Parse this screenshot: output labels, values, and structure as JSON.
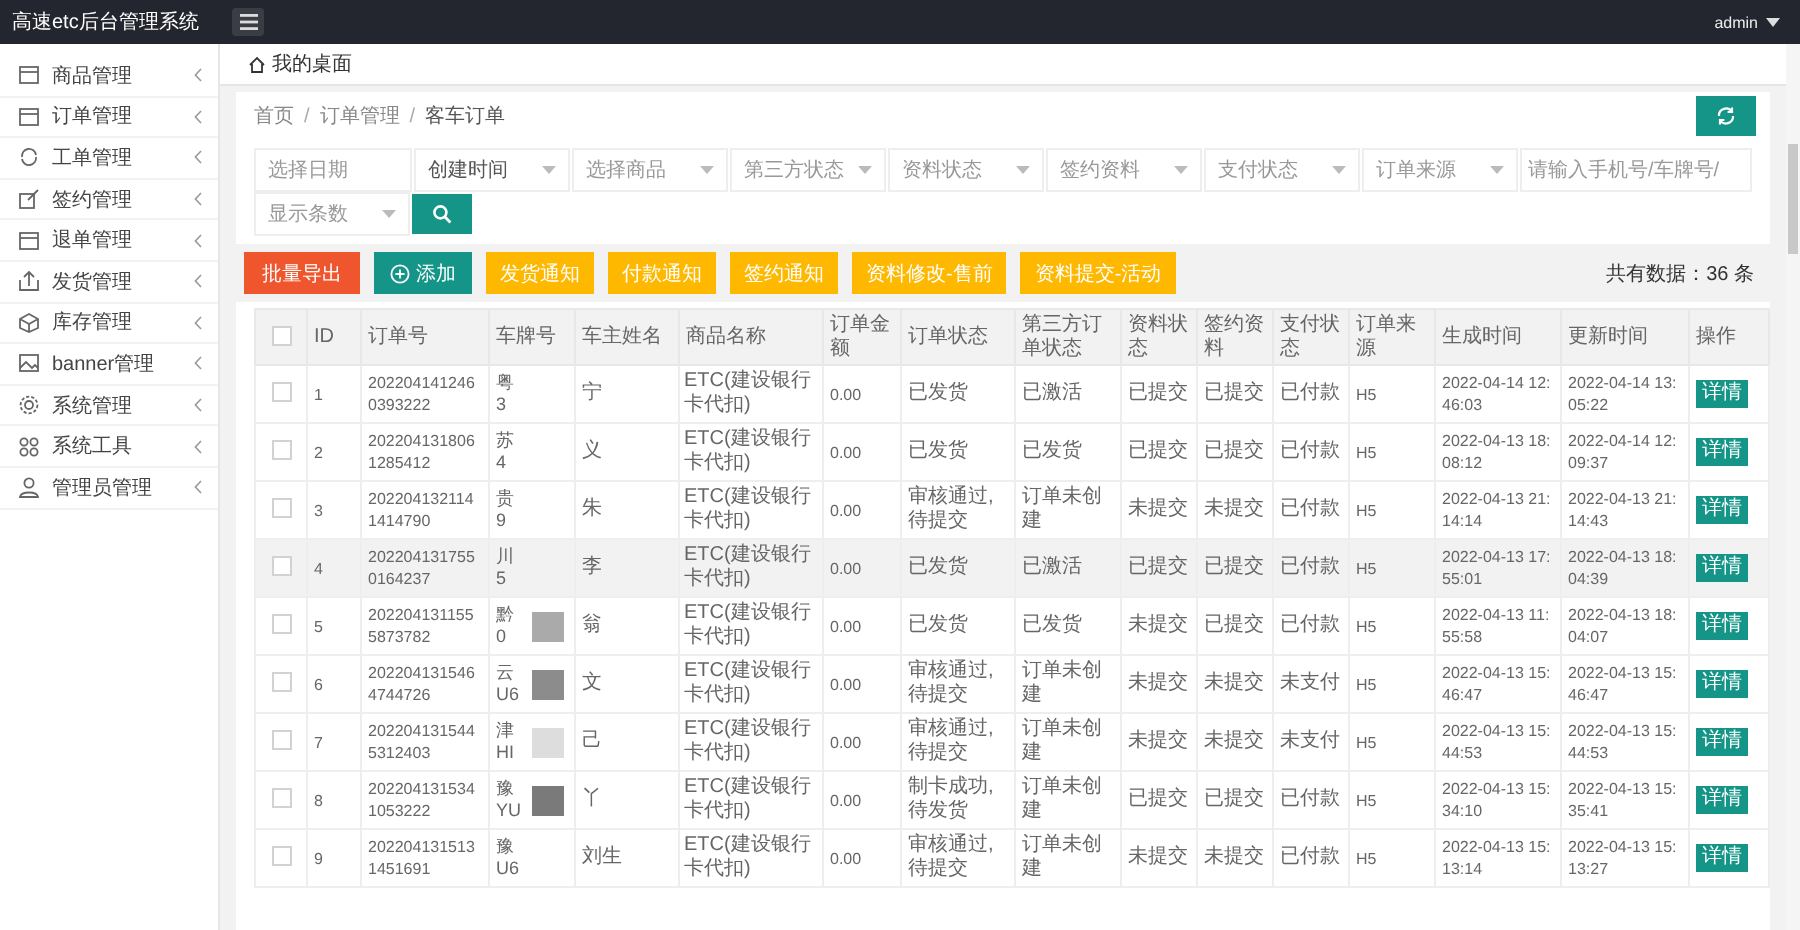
{
  "app_title": "高速etc后台管理系统",
  "user": "admin",
  "sidebar": {
    "items": [
      {
        "label": "商品管理"
      },
      {
        "label": "订单管理"
      },
      {
        "label": "工单管理"
      },
      {
        "label": "签约管理"
      },
      {
        "label": "退单管理"
      },
      {
        "label": "发货管理"
      },
      {
        "label": "库存管理"
      },
      {
        "label": "banner管理"
      },
      {
        "label": "系统管理"
      },
      {
        "label": "系统工具"
      },
      {
        "label": "管理员管理"
      }
    ]
  },
  "tab": {
    "label": "我的桌面"
  },
  "breadcrumb": {
    "separator": "/",
    "items": [
      "首页",
      "订单管理",
      "客车订单"
    ]
  },
  "filters": [
    {
      "kind": "input",
      "placeholder": "选择日期"
    },
    {
      "kind": "select",
      "value": "创建时间"
    },
    {
      "kind": "select",
      "placeholder": "选择商品"
    },
    {
      "kind": "select",
      "placeholder": "第三方状态"
    },
    {
      "kind": "select",
      "placeholder": "资料状态"
    },
    {
      "kind": "select",
      "placeholder": "签约资料"
    },
    {
      "kind": "select",
      "placeholder": "支付状态"
    },
    {
      "kind": "select",
      "placeholder": "订单来源"
    },
    {
      "kind": "input",
      "placeholder": "请输入手机号/车牌号/"
    },
    {
      "kind": "select",
      "placeholder": "显示条数"
    }
  ],
  "actions": [
    {
      "label": "批量导出",
      "kind": "danger"
    },
    {
      "label": "添加",
      "kind": "primary"
    },
    {
      "label": "发货通知",
      "kind": "warning"
    },
    {
      "label": "付款通知",
      "kind": "warning"
    },
    {
      "label": "签约通知",
      "kind": "warning"
    },
    {
      "label": "资料修改-售前",
      "kind": "warning"
    },
    {
      "label": "资料提交-活动",
      "kind": "warning"
    }
  ],
  "total": "共有数据：36 条",
  "table": {
    "all_checked": false,
    "columns": [
      "ID",
      "订单号",
      "车牌号",
      "车主姓名",
      "商品名称",
      "订单金额",
      "订单状态",
      "第三方订单状态",
      "资料状态",
      "签约资料",
      "支付状态",
      "订单来源",
      "生成时间",
      "更新时间",
      "操作"
    ],
    "rows": [
      {
        "checked": false,
        "highlighted": false,
        "id": "1",
        "order_no": "2022041412460393222",
        "plate": "粤\n3",
        "owner": "宁",
        "product": "ETC(建设银行卡代扣)",
        "amount": "0.00",
        "status": "已发货",
        "third_status": "已激活",
        "docs": "已提交",
        "sign": "已提交",
        "pay": "已付款",
        "source": "H5",
        "created": "2022-04-14 12:46:03",
        "updated": "2022-04-14 13:05:22",
        "action": "详情"
      },
      {
        "checked": false,
        "highlighted": false,
        "id": "2",
        "order_no": "2022041318061285412",
        "plate": "苏\n4",
        "owner": "义",
        "product": "ETC(建设银行卡代扣)",
        "amount": "0.00",
        "status": "已发货",
        "third_status": "已发货",
        "docs": "已提交",
        "sign": "已提交",
        "pay": "已付款",
        "source": "H5",
        "created": "2022-04-13 18:08:12",
        "updated": "2022-04-14 12:09:37",
        "action": "详情"
      },
      {
        "checked": false,
        "highlighted": false,
        "id": "3",
        "order_no": "2022041321141414790",
        "plate": "贵\n9",
        "owner": "朱",
        "product": "ETC(建设银行卡代扣)",
        "amount": "0.00",
        "status": "审核通过,待提交",
        "third_status": "订单未创建",
        "docs": "未提交",
        "sign": "未提交",
        "pay": "已付款",
        "source": "H5",
        "created": "2022-04-13 21:14:14",
        "updated": "2022-04-13 21:14:43",
        "action": "详情"
      },
      {
        "checked": false,
        "highlighted": true,
        "id": "4",
        "order_no": "2022041317550164237",
        "plate": "川\n5",
        "owner": "李",
        "product": "ETC(建设银行卡代扣)",
        "amount": "0.00",
        "status": "已发货",
        "third_status": "已激活",
        "docs": "已提交",
        "sign": "已提交",
        "pay": "已付款",
        "source": "H5",
        "created": "2022-04-13 17:55:01",
        "updated": "2022-04-13 18:04:39",
        "action": "详情"
      },
      {
        "checked": false,
        "highlighted": false,
        "id": "5",
        "order_no": "2022041311555873782",
        "plate": "黔\n0",
        "color": "#aaaaaa",
        "owner": "翁",
        "product": "ETC(建设银行卡代扣)",
        "amount": "0.00",
        "status": "已发货",
        "third_status": "已发货",
        "docs": "未提交",
        "sign": "已提交",
        "pay": "已付款",
        "source": "H5",
        "created": "2022-04-13 11:55:58",
        "updated": "2022-04-13 18:04:07",
        "action": "详情"
      },
      {
        "checked": false,
        "highlighted": false,
        "id": "6",
        "order_no": "2022041315464744726",
        "plate": "云\nU6",
        "color": "#8c8c8c",
        "owner": "文",
        "product": "ETC(建设银行卡代扣)",
        "amount": "0.00",
        "status": "审核通过,待提交",
        "third_status": "订单未创建",
        "docs": "未提交",
        "sign": "未提交",
        "pay": "未支付",
        "source": "H5",
        "created": "2022-04-13 15:46:47",
        "updated": "2022-04-13 15:46:47",
        "action": "详情"
      },
      {
        "checked": false,
        "highlighted": false,
        "id": "7",
        "order_no": "2022041315445312403",
        "plate": "津\nHI",
        "color": "#dddddd",
        "owner": "己",
        "product": "ETC(建设银行卡代扣)",
        "amount": "0.00",
        "status": "审核通过,待提交",
        "third_status": "订单未创建",
        "docs": "未提交",
        "sign": "未提交",
        "pay": "未支付",
        "source": "H5",
        "created": "2022-04-13 15:44:53",
        "updated": "2022-04-13 15:44:53",
        "action": "详情"
      },
      {
        "checked": false,
        "highlighted": false,
        "id": "8",
        "order_no": "2022041315341053222",
        "plate": "豫\nYU",
        "color": "#7a7a7a",
        "owner": "丫",
        "product": "ETC(建设银行卡代扣)",
        "amount": "0.00",
        "status": "制卡成功,待发货",
        "third_status": "订单未创建",
        "docs": "已提交",
        "sign": "已提交",
        "pay": "已付款",
        "source": "H5",
        "created": "2022-04-13 15:34:10",
        "updated": "2022-04-13 15:35:41",
        "action": "详情"
      },
      {
        "checked": false,
        "highlighted": false,
        "id": "9",
        "order_no": "2022041315131451691",
        "plate": "豫\nU6",
        "owner": "刘生",
        "product": "ETC(建设银行卡代扣)",
        "amount": "0.00",
        "status": "审核通过,待提交",
        "third_status": "订单未创建",
        "docs": "未提交",
        "sign": "未提交",
        "pay": "已付款",
        "source": "H5",
        "created": "2022-04-13 15:13:14",
        "updated": "2022-04-13 15:13:27",
        "action": "详情"
      }
    ]
  }
}
